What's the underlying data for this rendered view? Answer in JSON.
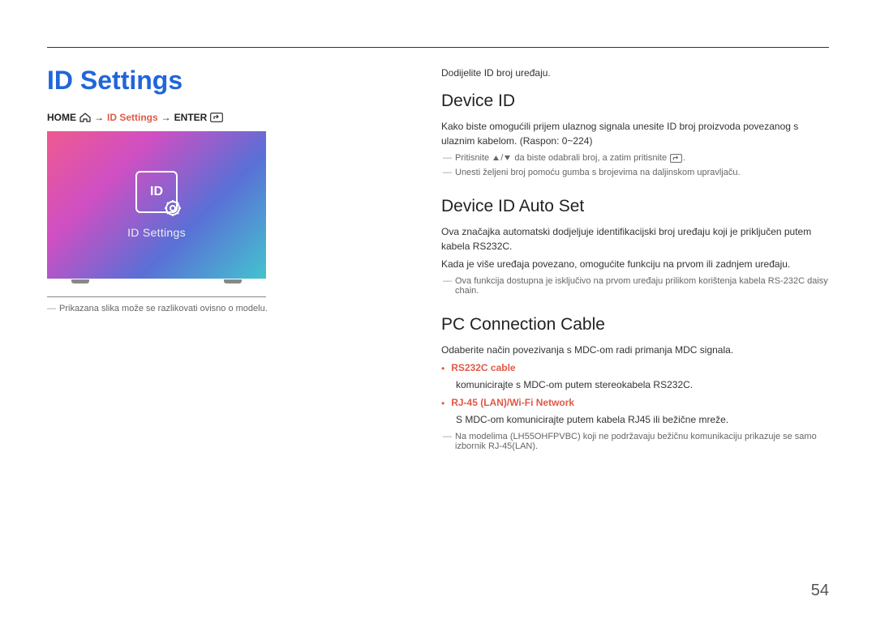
{
  "page": {
    "title": "ID Settings",
    "number": "54"
  },
  "breadcrumb": {
    "home": "HOME",
    "settings": "ID Settings",
    "enter": "ENTER"
  },
  "screenshot": {
    "icon_label": "ID",
    "caption": "ID Settings"
  },
  "left_footnote": "Prikazana slika može se razlikovati ovisno o modelu.",
  "right": {
    "intro": "Dodijelite ID broj uređaju.",
    "device_id": {
      "heading": "Device ID",
      "p1": "Kako biste omogućili prijem ulaznog signala unesite ID broj proizvoda povezanog s ulaznim kabelom. (Raspon: 0~224)",
      "note1_pre": "Pritisnite",
      "note1_mid": "da biste odabrali broj, a zatim pritisnite",
      "note1_post": ".",
      "note2": "Unesti željeni broj pomoću gumba s brojevima na daljinskom upravljaču."
    },
    "auto_set": {
      "heading": "Device ID Auto Set",
      "p1": "Ova značajka automatski dodjeljuje identifikacijski broj uređaju koji je priključen putem kabela RS232C.",
      "p2": "Kada je više uređaja povezano, omogućite funkciju na prvom ili zadnjem uređaju.",
      "note1": "Ova funkcija dostupna je isključivo na prvom uređaju prilikom korištenja kabela RS-232C daisy chain."
    },
    "pc_cable": {
      "heading": "PC Connection Cable",
      "intro": "Odaberite način povezivanja s MDC-om radi primanja MDC signala.",
      "item1_label": "RS232C cable",
      "item1_desc": "komunicirajte s MDC-om putem stereokabela RS232C.",
      "item2_label": "RJ-45 (LAN)/Wi-Fi Network",
      "item2_desc": "S MDC-om komunicirajte putem kabela RJ45 ili bežične mreže.",
      "item2_note": "Na modelima (LH55OHFPVBC) koji ne podržavaju bežičnu komunikaciju prikazuje se samo izbornik RJ-45(LAN)."
    }
  }
}
